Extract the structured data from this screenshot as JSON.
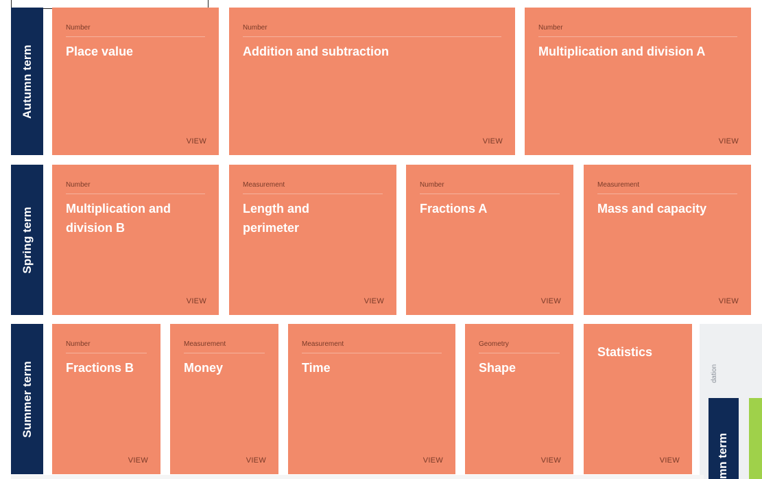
{
  "terms": {
    "autumn": "Autumn term",
    "spring": "Spring term",
    "summer": "Summer term"
  },
  "view_label": "VIEW",
  "autumn": [
    {
      "category": "Number",
      "title": "Place value"
    },
    {
      "category": "Number",
      "title": "Addition and subtraction"
    },
    {
      "category": "Number",
      "title": "Multiplication and division A"
    }
  ],
  "spring": [
    {
      "category": "Number",
      "title": "Multiplication and division B"
    },
    {
      "category": "Measurement",
      "title": "Length and perimeter"
    },
    {
      "category": "Number",
      "title": "Fractions A"
    },
    {
      "category": "Measurement",
      "title": "Mass and capacity"
    }
  ],
  "summer": [
    {
      "category": "Number",
      "title": "Fractions B"
    },
    {
      "category": "Measurement",
      "title": "Money"
    },
    {
      "category": "Measurement",
      "title": "Time"
    },
    {
      "category": "Geometry",
      "title": "Shape"
    },
    {
      "category": "",
      "title": "Statistics"
    }
  ],
  "next_panel": {
    "side_label": "dation",
    "term_label": "mn term"
  },
  "colors": {
    "card": "#f28a6a",
    "term_bar": "#0f2a56",
    "green_strip": "#9fd14a"
  }
}
